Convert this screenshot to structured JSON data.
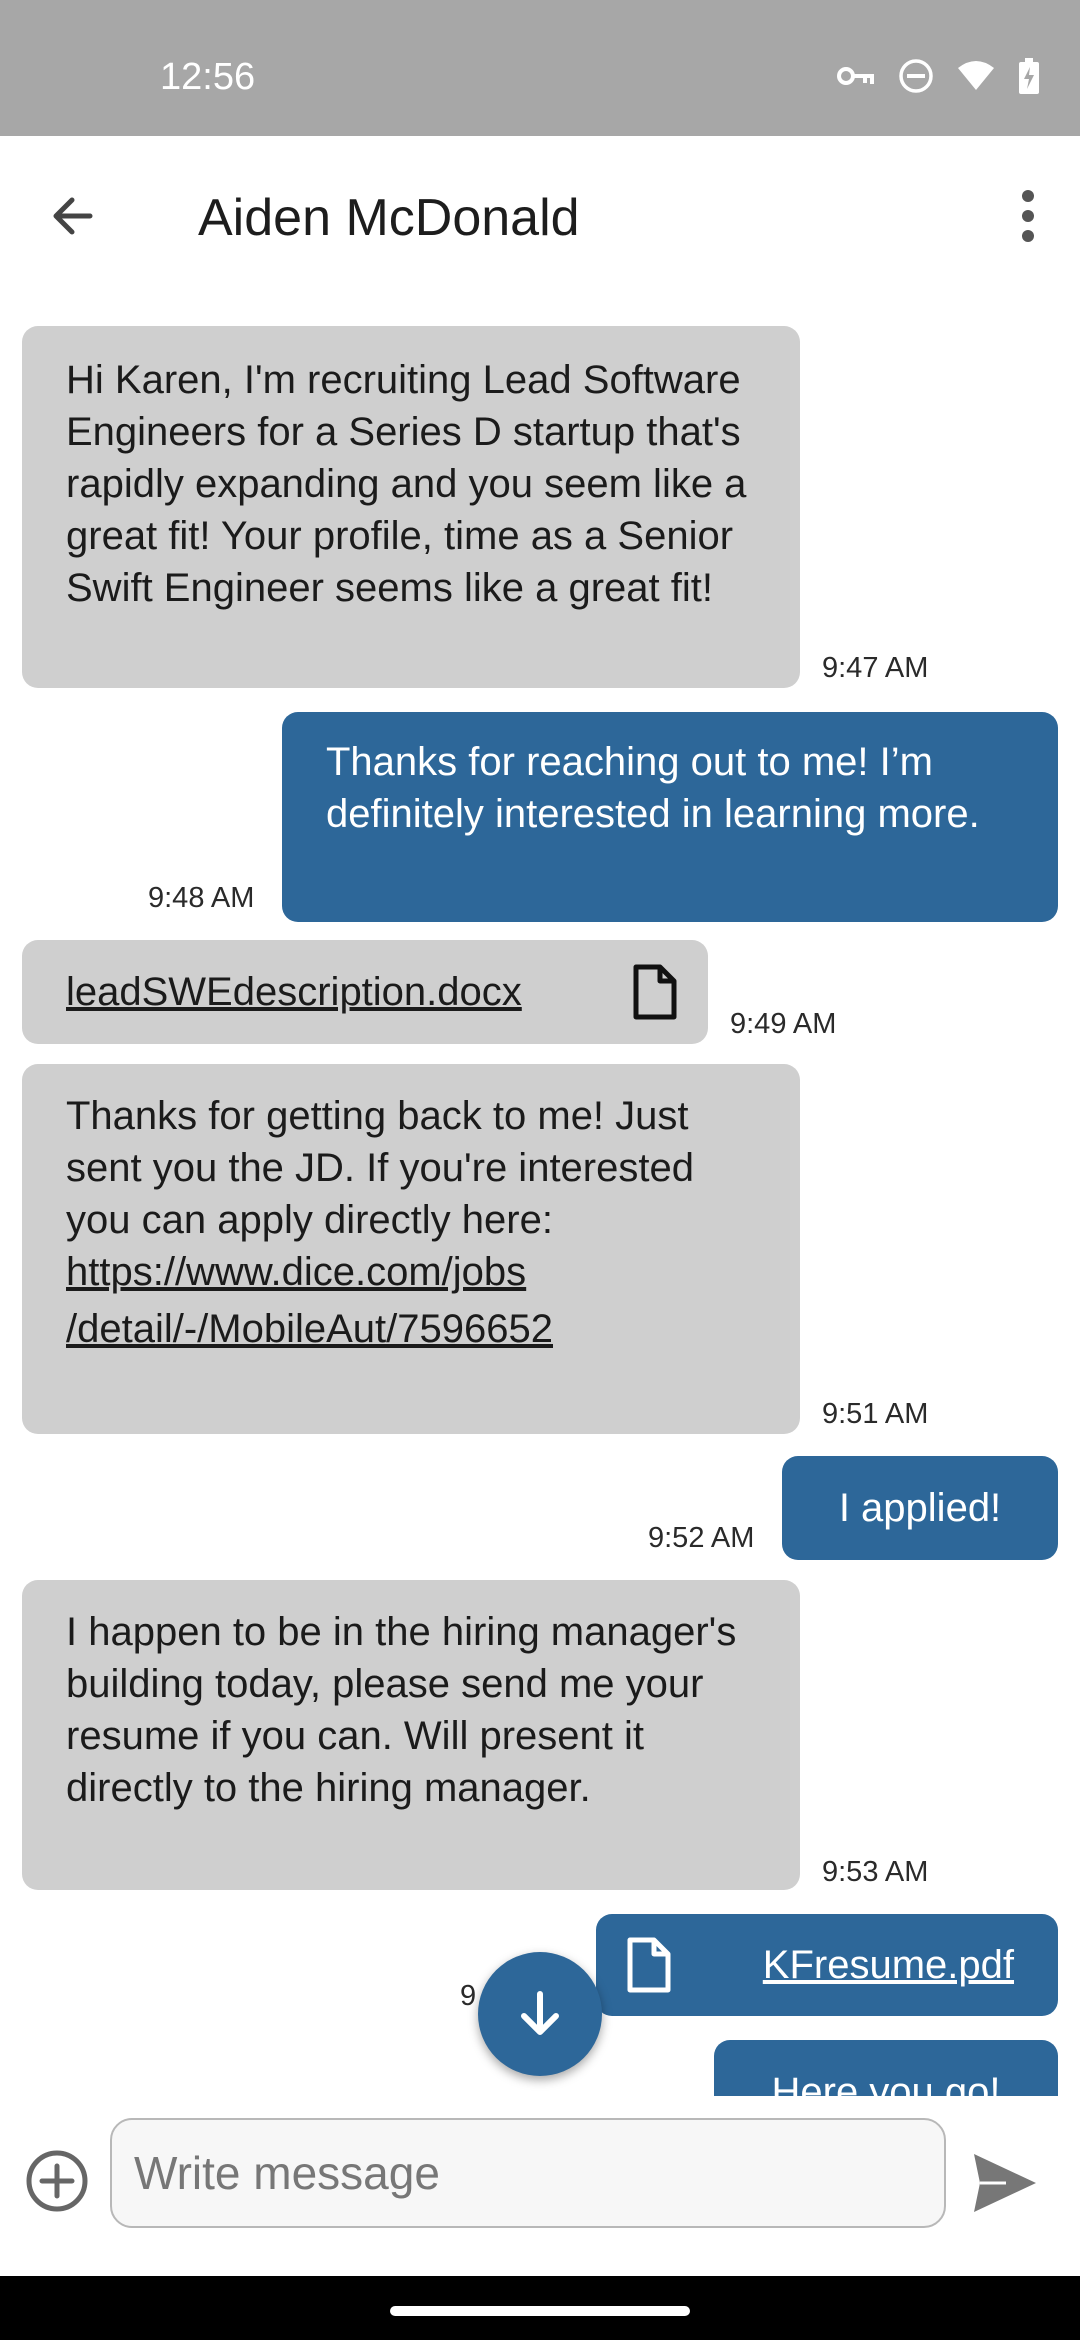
{
  "status_bar": {
    "time": "12:56"
  },
  "header": {
    "title": "Aiden McDonald"
  },
  "messages": [
    {
      "text": "Hi Karen, I'm recruiting Lead Software Engineers for a Series D startup that's rapidly expanding and you seem like a great fit! Your profile, time as a Senior Swift Engineer seems like a great fit!",
      "time": "9:47 AM"
    },
    {
      "text": "Thanks for reaching out to me! I’m definitely interested in learning more.",
      "time": "9:48 AM"
    },
    {
      "file_name": "leadSWEdescription.docx",
      "time": "9:49 AM"
    },
    {
      "text_before_link": "Thanks for getting back to me! Just sent you the JD. If you're interested you can apply directly here: ",
      "link_line1": "https://www.dice.com/jobs",
      "link_line2": "/detail/-/MobileAut/7596652",
      "time": "9:51 AM"
    },
    {
      "text": "I applied!",
      "time": "9:52 AM"
    },
    {
      "text": "I happen to be in the hiring manager's building today, please send me your resume if you can. Will present it directly to the hiring manager.",
      "time": "9:53 AM"
    },
    {
      "file_name": "KFresume.pdf",
      "time_partial": "9"
    },
    {
      "text_partial": "Here you go!"
    }
  ],
  "composer": {
    "placeholder": "Write message"
  }
}
